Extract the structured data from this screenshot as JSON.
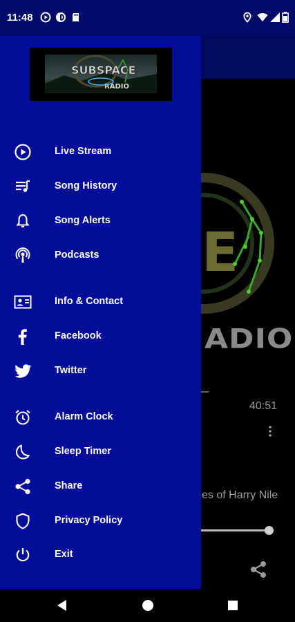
{
  "status_bar": {
    "time": "11:48",
    "left_icons": [
      "media-icon",
      "data-saver-icon",
      "sd-card-icon"
    ],
    "right_icons": [
      "location-icon",
      "wifi-icon",
      "signal-icon",
      "battery-icon"
    ]
  },
  "drawer": {
    "logo": {
      "name": "station-logo",
      "line1": "SUBSPACE",
      "line2": "RADIO"
    },
    "menu_groups": [
      [
        {
          "id": "live-stream",
          "label": "Live Stream",
          "icon": "play-circle-icon"
        },
        {
          "id": "song-history",
          "label": "Song History",
          "icon": "playlist-icon"
        },
        {
          "id": "song-alerts",
          "label": "Song Alerts",
          "icon": "bell-icon"
        },
        {
          "id": "podcasts",
          "label": "Podcasts",
          "icon": "podcast-icon"
        }
      ],
      [
        {
          "id": "info-contact",
          "label": "Info & Contact",
          "icon": "contact-card-icon"
        },
        {
          "id": "facebook",
          "label": "Facebook",
          "icon": "facebook-icon"
        },
        {
          "id": "twitter",
          "label": "Twitter",
          "icon": "twitter-icon"
        }
      ],
      [
        {
          "id": "alarm-clock",
          "label": "Alarm Clock",
          "icon": "alarm-clock-icon"
        },
        {
          "id": "sleep-timer",
          "label": "Sleep Timer",
          "icon": "moon-icon"
        },
        {
          "id": "share",
          "label": "Share",
          "icon": "share-icon"
        },
        {
          "id": "privacy-policy",
          "label": "Privacy Policy",
          "icon": "shield-icon"
        },
        {
          "id": "exit",
          "label": "Exit",
          "icon": "power-icon"
        }
      ]
    ]
  },
  "background_player": {
    "art_text": "ADIO",
    "duration": "40:51",
    "episode_title": "es of Harry Nile",
    "progress": 0.99,
    "icons": [
      "more-vert-icon",
      "share-icon"
    ]
  },
  "nav_bar": {
    "buttons": [
      "back-button",
      "home-button",
      "recents-button"
    ]
  },
  "colors": {
    "drawer_bg": "#030d9a",
    "status_bar_bg": "#030b6a",
    "text": "#ffffff"
  }
}
